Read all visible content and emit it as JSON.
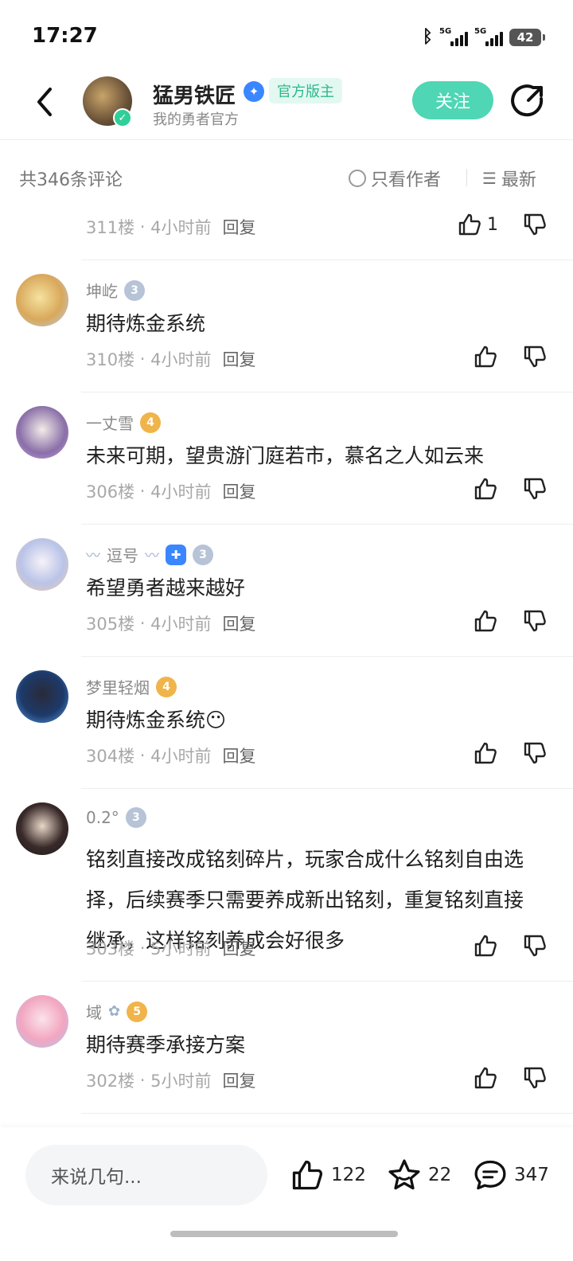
{
  "status": {
    "time": "17:27",
    "battery": "42",
    "signal1": "5G",
    "signal2": "5G"
  },
  "header": {
    "author_name": "猛男铁匠",
    "badge": "官方版主",
    "subtitle": "我的勇者官方",
    "follow_label": "关注"
  },
  "sort": {
    "count_text": "共346条评论",
    "author_only": "只看作者",
    "latest": "最新"
  },
  "comments": [
    {
      "name": "",
      "level": "",
      "text": "",
      "floor": "311楼",
      "time": "4小时前",
      "reply": "回复",
      "likes": "1"
    },
    {
      "name": "坤屹",
      "level": "3",
      "text": "期待炼金系统",
      "floor": "310楼",
      "time": "4小时前",
      "reply": "回复",
      "likes": ""
    },
    {
      "name": "一丈雪",
      "level": "4",
      "text": "未来可期，望贵游门庭若市，慕名之人如云来",
      "floor": "306楼",
      "time": "4小时前",
      "reply": "回复",
      "likes": ""
    },
    {
      "name": "逗号",
      "level": "3",
      "text": "希望勇者越来越好",
      "floor": "305楼",
      "time": "4小时前",
      "reply": "回复",
      "likes": ""
    },
    {
      "name": "梦里轻烟",
      "level": "4",
      "text": "期待炼金系统",
      "floor": "304楼",
      "time": "4小时前",
      "reply": "回复",
      "likes": ""
    },
    {
      "name": "0.2°",
      "level": "3",
      "text": "铭刻直接改成铭刻碎片，玩家合成什么铭刻自由选择，后续赛季只需要养成新出铭刻，重复铭刻直接继承，这样铭刻养成会好很多",
      "floor": "303楼",
      "time": "5小时前",
      "reply": "回复",
      "likes": ""
    },
    {
      "name": "域",
      "level": "5",
      "text": "期待赛季承接方案",
      "floor": "302楼",
      "time": "5小时前",
      "reply": "回复",
      "likes": ""
    }
  ],
  "bottom": {
    "placeholder": "来说几句...",
    "likes": "122",
    "stars": "22",
    "comments": "347"
  }
}
